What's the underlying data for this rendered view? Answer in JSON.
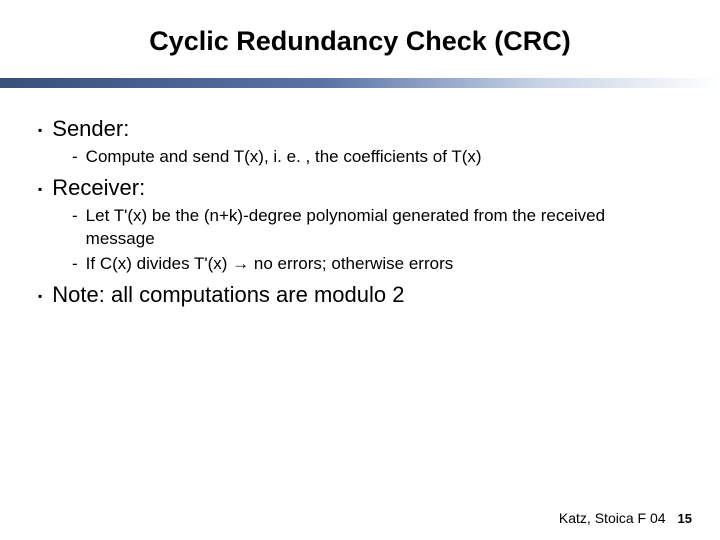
{
  "title": "Cyclic Redundancy Check (CRC)",
  "bullets": {
    "sender": {
      "label": "Sender:",
      "sub": {
        "a": "Compute and send T(x), i. e. , the coefficients of T(x)"
      }
    },
    "receiver": {
      "label": "Receiver:",
      "sub": {
        "a": "Let T'(x) be the (n+k)-degree polynomial generated from the received message",
        "b": "If C(x) divides T'(x) → no errors; otherwise errors"
      }
    },
    "note": {
      "label": "Note: all computations are modulo 2"
    }
  },
  "footer": {
    "credit": "Katz, Stoica F 04",
    "page": "15"
  }
}
